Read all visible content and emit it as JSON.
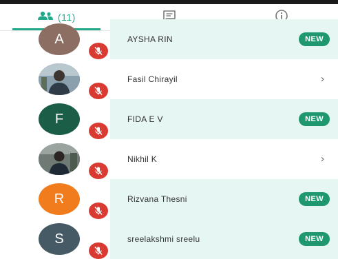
{
  "tabs": {
    "members_count": "(11)"
  },
  "members": [
    {
      "initial": "A",
      "name": "AYSHA RIN",
      "badge": "NEW",
      "avatar_color": "#8d6e63",
      "status": "new"
    },
    {
      "initial": "",
      "name": "Fasil Chirayil",
      "badge": "",
      "avatar_color": "#6b7f8e",
      "status": "open"
    },
    {
      "initial": "F",
      "name": "FIDA E V",
      "badge": "NEW",
      "avatar_color": "#1b5e48",
      "status": "new"
    },
    {
      "initial": "",
      "name": "Nikhil K",
      "badge": "",
      "avatar_color": "#55606a",
      "status": "open"
    },
    {
      "initial": "R",
      "name": "Rizvana Thesni",
      "badge": "NEW",
      "avatar_color": "#f07c1e",
      "status": "new"
    },
    {
      "initial": "S",
      "name": "sreelakshmi sreelu",
      "badge": "NEW",
      "avatar_color": "#455a64",
      "status": "new"
    }
  ],
  "colors": {
    "accent": "#21a98a",
    "new_badge": "#1f9870",
    "mute_badge": "#d93b32",
    "new_row_bg": "#e6f6f2"
  },
  "icons": {
    "members_tab": "people-icon",
    "chat_tab": "message-icon",
    "info_tab": "info-icon",
    "row_badge": "mic-off-icon",
    "row_open": "chevron-right-icon"
  }
}
